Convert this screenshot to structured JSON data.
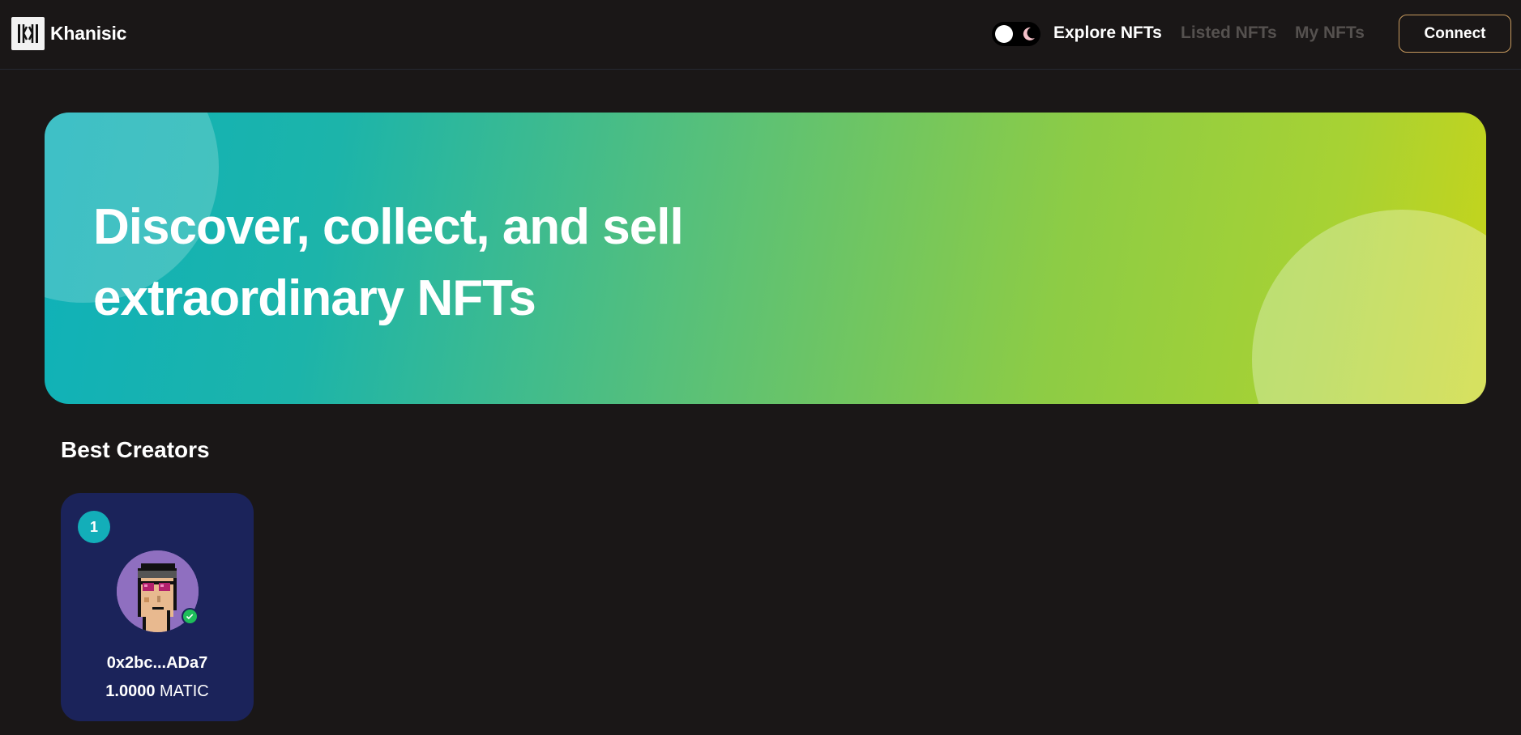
{
  "brand": {
    "name": "Khanisic",
    "logo_icon": "khanisic-logo-icon"
  },
  "nav": {
    "theme_toggle": {
      "state": "dark",
      "icons": [
        "sun-knob-icon",
        "moon-icon"
      ]
    },
    "links": [
      {
        "label": "Explore NFTs",
        "active": true
      },
      {
        "label": "Listed NFTs",
        "active": false
      },
      {
        "label": "My NFTs",
        "active": false
      }
    ],
    "connect_label": "Connect"
  },
  "hero": {
    "line1": "Discover, collect, and sell",
    "line2": "extraordinary NFTs",
    "gradient": [
      "#0fb1b9",
      "#c7d41a"
    ]
  },
  "best_creators": {
    "title": "Best Creators",
    "items": [
      {
        "rank": "1",
        "address": "0x2bc...ADa7",
        "amount": "1.0000",
        "currency": "MATIC",
        "verified": true,
        "avatar_icon": "pixel-punk-avatar"
      }
    ]
  },
  "colors": {
    "background": "#1a1717",
    "card": "#1b235a",
    "accent": "#13aeb9",
    "connect_border": "#c79a5e",
    "inactive_link": "#55514f"
  }
}
